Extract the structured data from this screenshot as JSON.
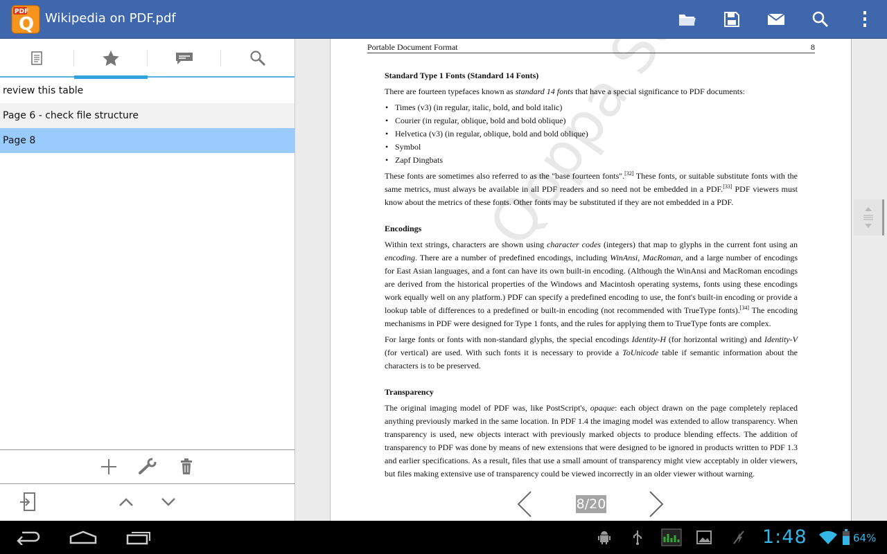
{
  "app": {
    "title": "Wikipedia on PDF.pdf",
    "icon_label": "PDF",
    "icon_letter": "Q"
  },
  "toolbar": {
    "icons": [
      "folder-icon",
      "save-icon",
      "mail-icon",
      "search-icon",
      "overflow-menu-icon"
    ]
  },
  "sidebar": {
    "tabs": [
      "page-list-icon",
      "star-icon",
      "annotation-icon",
      "search-icon"
    ],
    "active_tab": 1,
    "bookmarks": [
      {
        "label": "review this table"
      },
      {
        "label": "Page 6 - check file structure"
      },
      {
        "label": "Page 8",
        "selected": true
      }
    ],
    "tools": [
      "add-icon",
      "wrench-icon",
      "trash-icon"
    ],
    "nav": [
      "go-to-page-icon",
      "chevron-up-icon",
      "chevron-down-icon"
    ]
  },
  "document": {
    "header_title": "Portable Document Format",
    "header_page": "8",
    "sections": {
      "fonts_heading": "Standard Type 1 Fonts (Standard 14 Fonts)",
      "fonts_intro_a": "There are fourteen typefaces known as ",
      "fonts_intro_em": "standard 14 fonts",
      "fonts_intro_b": " that have a special significance to PDF documents:",
      "font_list": [
        "Times (v3) (in regular, italic, bold, and bold italic)",
        "Courier (in regular, oblique, bold and bold oblique)",
        "Helvetica (v3) (in regular, oblique, bold and bold oblique)",
        "Symbol",
        "Zapf Dingbats"
      ],
      "fonts_para_a": "These fonts are sometimes also referred to as the \"base fourteen fonts\".",
      "fonts_ref1": "[32]",
      "fonts_para_b": " These fonts, or suitable substitute fonts with the same metrics, must always be available in all PDF readers and so need not be embedded in a PDF.",
      "fonts_ref2": "[33]",
      "fonts_para_c": " PDF viewers must know about the metrics of these fonts. Other fonts may be substituted if they are not embedded in a PDF.",
      "enc_heading": "Encodings",
      "enc_p1_a": "Within text strings, characters are shown using ",
      "enc_p1_em1": "character codes",
      "enc_p1_b": " (integers) that map to glyphs in the current font using an ",
      "enc_p1_em2": "encoding",
      "enc_p1_c": ". There are a number of predefined encodings, including ",
      "enc_p1_em3": "WinAnsi",
      "enc_p1_d": ", ",
      "enc_p1_em4": "MacRoman",
      "enc_p1_e": ", and a large number of encodings for East Asian languages, and a font can have its own built-in encoding. (Although the WinAnsi and MacRoman encodings are derived from the historical properties of the Windows and Macintosh operating systems, fonts using these encodings work equally well on any platform.) PDF can specify a predefined encoding to use, the font's built-in encoding or provide a lookup table of differences to a predefined or built-in encoding (not recommended with TrueType fonts).",
      "enc_ref": "[34]",
      "enc_p1_f": " The encoding mechanisms in PDF were designed for Type 1 fonts, and the rules for applying them to TrueType fonts are complex.",
      "enc_p2_a": "For large fonts or fonts with non-standard glyphs, the special encodings ",
      "enc_p2_em1": "Identity-H",
      "enc_p2_b": " (for horizontal writing) and ",
      "enc_p2_em2": "Identity-V",
      "enc_p2_c": " (for vertical) are used. With such fonts it is necessary to provide a ",
      "enc_p2_em3": "ToUnicode",
      "enc_p2_d": " table if semantic information about the characters is to be preserved.",
      "tr_heading": "Transparency",
      "tr_p1_a": "The original imaging model of PDF was, like PostScript's, ",
      "tr_p1_em": "opaque",
      "tr_p1_b": ": each object drawn on the page completely replaced anything previously marked in the same location. In PDF 1.4 the imaging model was extended to allow transparency. When transparency is used, new objects interact with previously marked objects to produce blending effects. The addition of transparency to PDF was done by means of new extensions that were designed to be ignored in products written to PDF 1.3 and earlier specifications. As a result, files that use a small amount of transparency might view acceptably in older viewers, but files making extensive use of transparency could be viewed incorrectly in an older viewer without warning."
    },
    "watermark": "Qoppa Software",
    "page_counter": "8/20",
    "current_page": 8,
    "total_pages": 20
  },
  "system": {
    "clock": "1:48",
    "battery": "64%",
    "nav_buttons": [
      "back-icon",
      "home-icon",
      "recents-icon"
    ],
    "status_icons": [
      "android-debug-icon",
      "usb-icon",
      "screenshot-app-icon",
      "gallery-icon",
      "no-sync-icon",
      "wifi-icon",
      "battery-icon"
    ]
  },
  "colors": {
    "action_bar": "#3f67ad",
    "tab_indicator": "#33a3e0",
    "selected_bookmark": "#99cbff",
    "status_accent": "#33b5e5"
  }
}
